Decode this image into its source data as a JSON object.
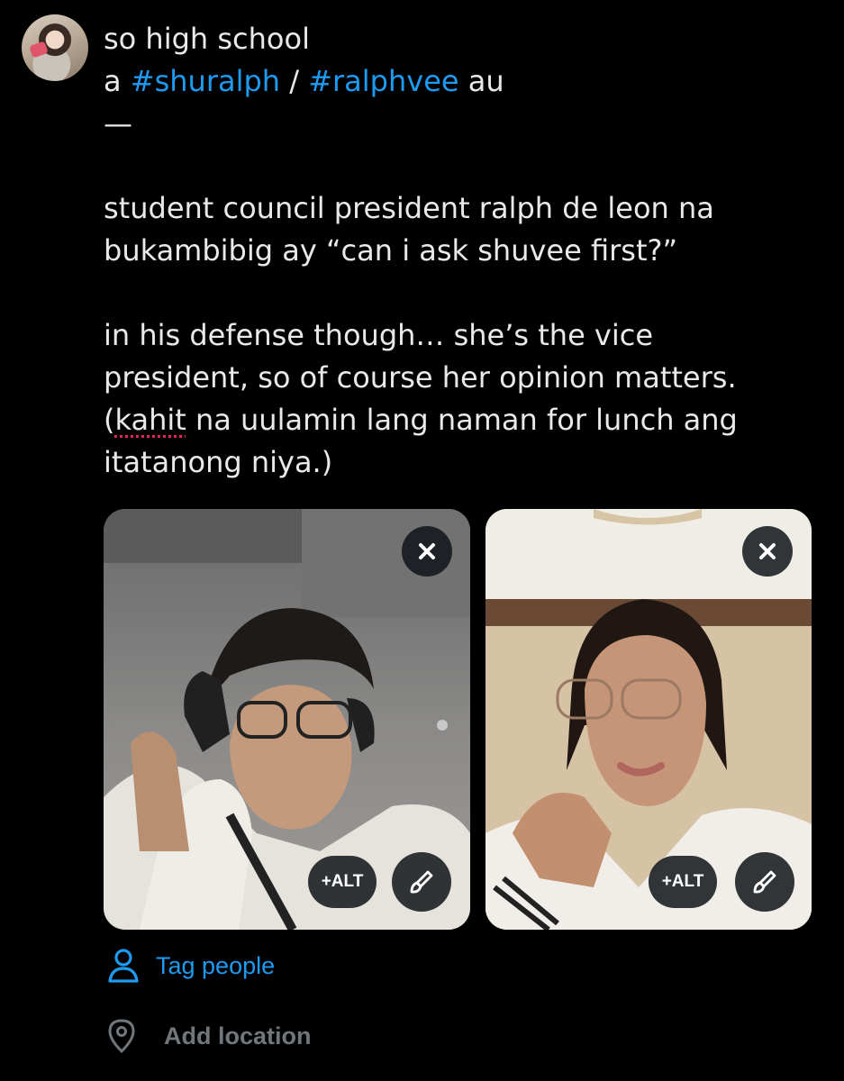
{
  "compose": {
    "lines": [
      "so high school",
      "",
      "/",
      "au",
      "—",
      "student council president ralph de leon na",
      "bukambibig ay “can i ask shuvee first?”",
      "in his defense though… she’s the vice",
      "president, so of course her opinion matters.",
      "(",
      "kahit",
      " na uulamin lang naman for lunch ang",
      "itatanong niya.)"
    ],
    "prefix_a": "a ",
    "hashtag_1": "#shuralph",
    "separator": " / ",
    "hashtag_2": "#ralphvee",
    "suffix": " au"
  },
  "media": [
    {
      "alt_label": "+ALT",
      "remove_icon": "close-icon",
      "edit_icon": "paintbrush-icon"
    },
    {
      "alt_label": "+ALT",
      "remove_icon": "close-icon",
      "edit_icon": "paintbrush-icon"
    }
  ],
  "actions": {
    "tag_people": "Tag people",
    "add_location": "Add location"
  },
  "colors": {
    "background": "#000000",
    "text": "#e7e9ea",
    "accent": "#1d9bf0",
    "muted": "#71767b",
    "spellcheck": "#e0245e"
  }
}
